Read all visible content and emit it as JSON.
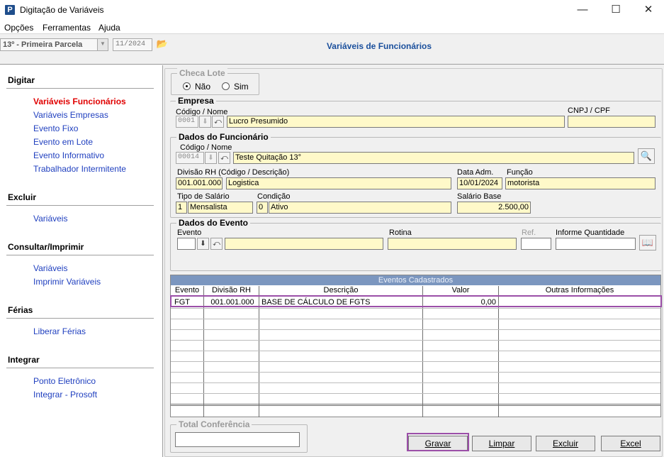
{
  "window": {
    "title": "Digitação de Variáveis",
    "app_icon": "P"
  },
  "menu": [
    "Opções",
    "Ferramentas",
    "Ajuda"
  ],
  "toolbar": {
    "parcela": "13º - Primeira Parcela",
    "competencia": "11/2024"
  },
  "page_title": "Variáveis de Funcionários",
  "sidebar": {
    "digitar": {
      "title": "Digitar",
      "items": [
        "Variáveis Funcionários",
        "Variáveis Empresas",
        "Evento Fixo",
        "Evento em Lote",
        "Evento Informativo",
        "Trabalhador Intermitente"
      ]
    },
    "excluir": {
      "title": "Excluir",
      "items": [
        "Variáveis"
      ]
    },
    "consultar": {
      "title": "Consultar/Imprimir",
      "items": [
        "Variáveis",
        "Imprimir Variáveis"
      ]
    },
    "ferias": {
      "title": "Férias",
      "items": [
        "Liberar Férias"
      ]
    },
    "integrar": {
      "title": "Integrar",
      "items": [
        "Ponto Eletrônico",
        "Integrar - Prosoft"
      ]
    }
  },
  "checa_lote": {
    "title": "Checa Lote",
    "nao": "Não",
    "sim": "Sim",
    "selected": "Não"
  },
  "empresa": {
    "title": "Empresa",
    "codigo_label": "Código / Nome",
    "codigo": "0001",
    "nome": "Lucro Presumido",
    "cnpj_label": "CNPJ / CPF",
    "cnpj": ""
  },
  "funcionario": {
    "title": "Dados do Funcionário",
    "codigo_label": "Código / Nome",
    "codigo": "00014",
    "nome": "Teste Quitação 13°",
    "divisao_label": "Divisão RH (Código / Descrição)",
    "divisao_codigo": "001.001.000",
    "divisao_desc": "Logistica",
    "data_adm_label": "Data Adm.",
    "data_adm": "10/01/2024",
    "funcao_label": "Função",
    "funcao": "motorista",
    "tipo_salario_label": "Tipo de Salário",
    "tipo_salario_codigo": "1",
    "tipo_salario": "Mensalista",
    "condicao_label": "Condição",
    "condicao_codigo": "0",
    "condicao": "Ativo",
    "salario_base_label": "Salário Base",
    "salario_base": "2.500,00"
  },
  "evento": {
    "title": "Dados do Evento",
    "evento_label": "Evento",
    "rotina_label": "Rotina",
    "ref_label": "Ref.",
    "quantidade_label": "Informe Quantidade"
  },
  "grid": {
    "title": "Eventos Cadastrados",
    "columns": [
      "Evento",
      "Divisão RH",
      "Descrição",
      "Valor",
      "Outras Informações"
    ],
    "rows": [
      {
        "evento": "FGT",
        "divisao": "001.001.000",
        "descricao": "BASE DE CÁLCULO DE FGTS",
        "valor": "0,00",
        "outras": ""
      }
    ]
  },
  "total": {
    "title": "Total Conferência",
    "value": ""
  },
  "buttons": {
    "gravar": "Gravar",
    "limpar": "Limpar",
    "excluir": "Excluir",
    "excel": "Excel"
  },
  "colors": {
    "link": "#1f3fbf",
    "active_link": "#e00000",
    "title_blue": "#1a4f9c",
    "field_yellow": "#fff9c9",
    "highlight": "#9b4fa8",
    "grid_header": "#7b96bf"
  }
}
